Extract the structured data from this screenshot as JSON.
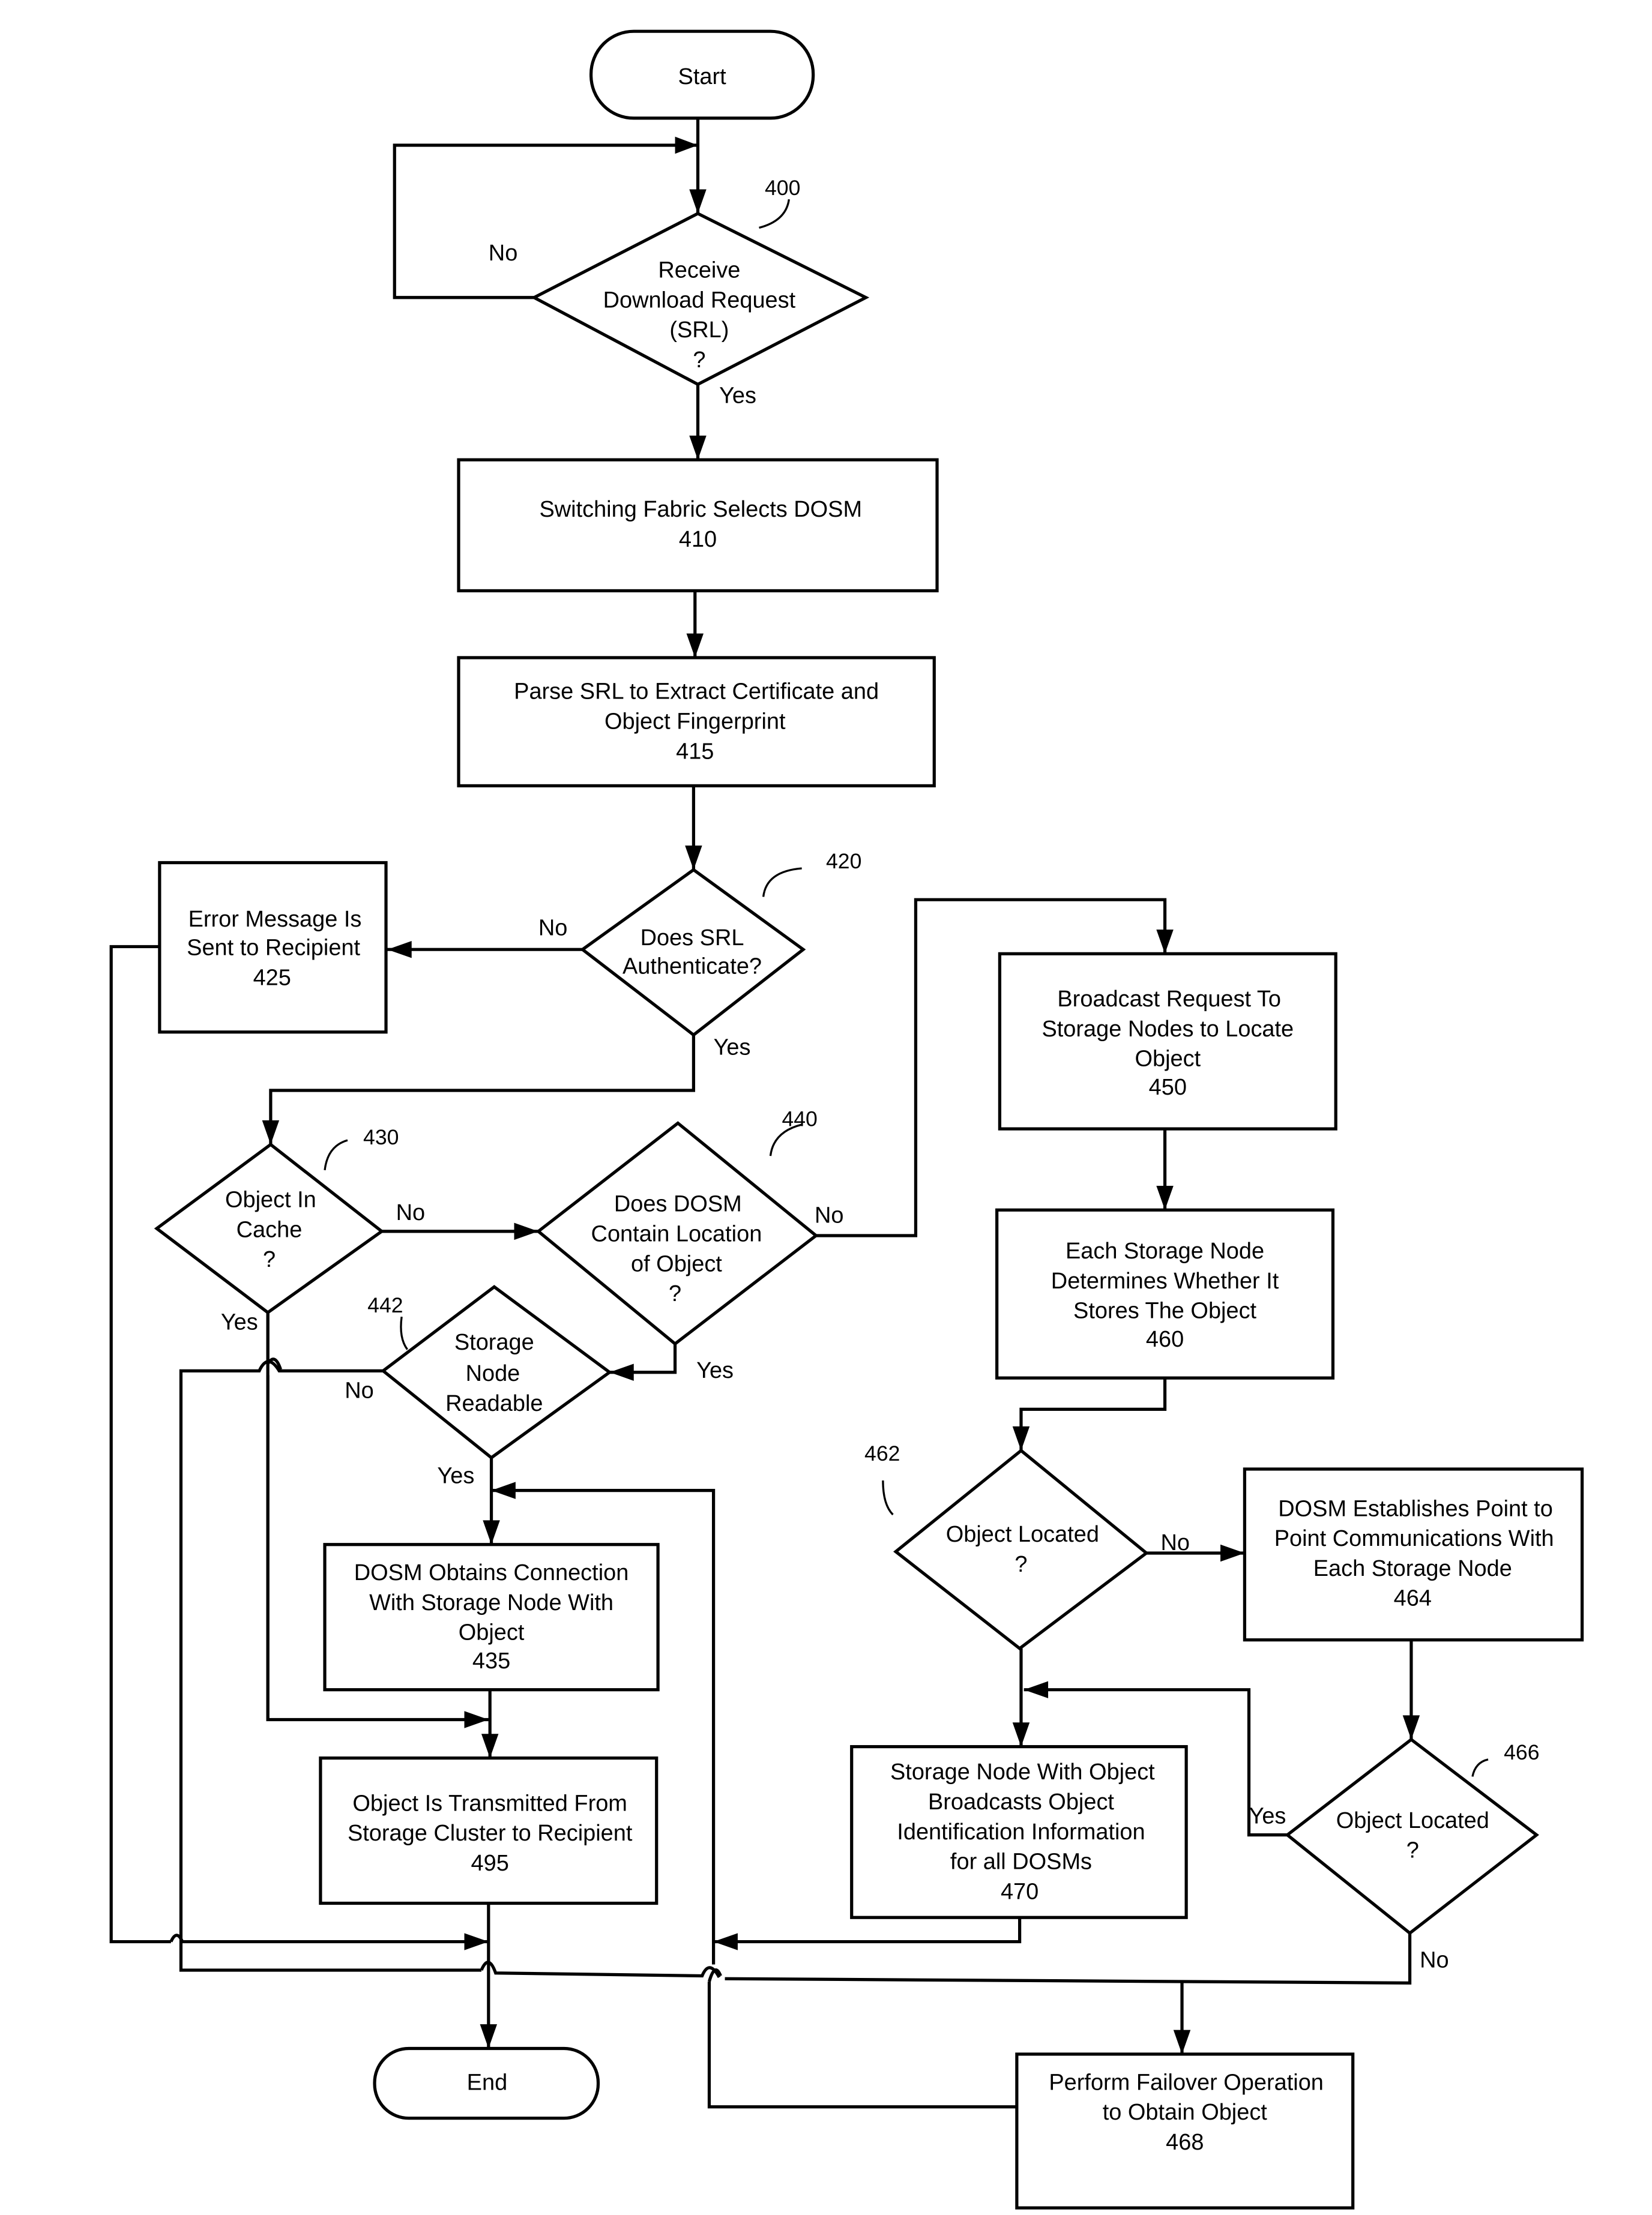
{
  "diagram": {
    "type": "flowchart",
    "nodes": {
      "start": {
        "lines": [
          "Start"
        ]
      },
      "n400": {
        "ref": "400",
        "lines": [
          "Receive",
          "Download Request",
          "(SRL)",
          "?"
        ]
      },
      "n410": {
        "lines": [
          "Switching Fabric Selects DOSM",
          "410"
        ]
      },
      "n415": {
        "lines": [
          "Parse SRL to Extract Certificate and",
          "Object Fingerprint",
          "415"
        ]
      },
      "n420": {
        "ref": "420",
        "lines": [
          "Does SRL",
          "Authenticate?"
        ]
      },
      "n425": {
        "lines": [
          "Error Message Is",
          "Sent to Recipient",
          "425"
        ]
      },
      "n430": {
        "ref": "430",
        "lines": [
          "Object In",
          "Cache",
          "?"
        ]
      },
      "n440": {
        "ref": "440",
        "lines": [
          "Does DOSM",
          "Contain Location",
          "of Object",
          "?"
        ]
      },
      "n442": {
        "ref": "442",
        "lines": [
          "Storage",
          "Node",
          "Readable"
        ]
      },
      "n435": {
        "lines": [
          "DOSM Obtains Connection",
          "With Storage Node With",
          "Object",
          "435"
        ]
      },
      "n495": {
        "lines": [
          "Object Is Transmitted From",
          "Storage Cluster to Recipient",
          "495"
        ]
      },
      "n450": {
        "lines": [
          "Broadcast Request To",
          "Storage Nodes to Locate",
          "Object",
          "450"
        ]
      },
      "n460": {
        "lines": [
          "Each Storage Node",
          "Determines Whether It",
          "Stores The Object",
          "460"
        ]
      },
      "n462": {
        "ref": "462",
        "lines": [
          "Object Located",
          "?"
        ]
      },
      "n464": {
        "lines": [
          "DOSM Establishes Point to",
          "Point Communications With",
          "Each Storage Node",
          "464"
        ]
      },
      "n466": {
        "ref": "466",
        "lines": [
          "Object Located",
          "?"
        ]
      },
      "n470": {
        "lines": [
          "Storage Node With Object",
          "Broadcasts Object",
          "Identification Information",
          "for all DOSMs",
          "470"
        ]
      },
      "n468": {
        "lines": [
          "Perform Failover Operation",
          "to Obtain Object",
          "468"
        ]
      },
      "end": {
        "lines": [
          "End"
        ]
      }
    },
    "edge_labels": {
      "n400_no": "No",
      "n400_yes": "Yes",
      "n420_no": "No",
      "n420_yes": "Yes",
      "n430_no": "No",
      "n430_yes": "Yes",
      "n440_no": "No",
      "n440_yes": "Yes",
      "n442_no": "No",
      "n442_yes": "Yes",
      "n462_no": "No",
      "n466_yes": "Yes",
      "n466_no": "No"
    }
  }
}
